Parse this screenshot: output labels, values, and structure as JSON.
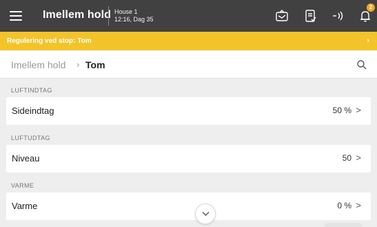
{
  "topbar": {
    "title": "Imellem hold",
    "house": "House 1",
    "time_day": "12:16, Dag 35",
    "icons": [
      "menu-icon",
      "house-status-icon",
      "checklist-icon",
      "wireless-icon",
      "bell-icon"
    ],
    "notification_count": "2"
  },
  "alert": {
    "text": "Regulering ved stop: Tom",
    "chevron": "›"
  },
  "breadcrumb": {
    "root": "Imellem hold",
    "separator": "›",
    "current": "Tom"
  },
  "sections": [
    {
      "label": "LUFTINDTAG",
      "row": {
        "label": "Sideindtag",
        "value": "50 %",
        "chevron": ">"
      }
    },
    {
      "label": "LUFTUDTAG",
      "row": {
        "label": "Niveau",
        "value": "50",
        "chevron": ">"
      }
    },
    {
      "label": "VARME",
      "row": {
        "label": "Varme",
        "value": "0 %",
        "chevron": ">"
      }
    }
  ],
  "colors": {
    "topbar": "#414141",
    "alert": "#f3c32a",
    "badge": "#f5a623",
    "background": "#eeeeee"
  }
}
